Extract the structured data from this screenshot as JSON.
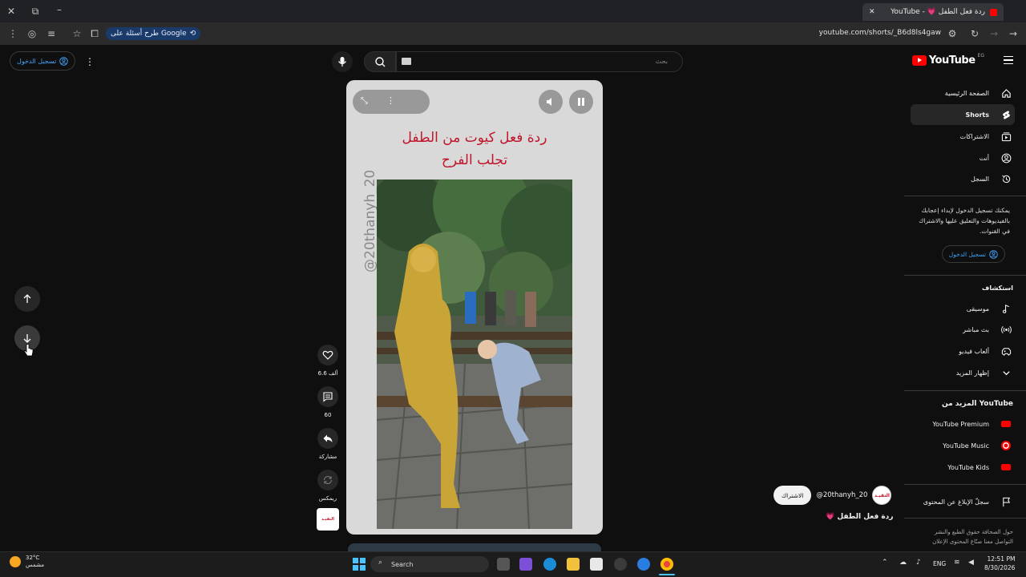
{
  "browser": {
    "tab_title": "ردة فعل الطفل 💗 - YouTube",
    "url": "youtube.com/shorts/_B6d8ls4gaw",
    "google_chip": "طرح أسئلة على Google"
  },
  "header": {
    "signin_label": "تسجيل الدخول",
    "search_placeholder": "بحث",
    "logo_text": "YouTube",
    "country_code": "EG"
  },
  "sidebar": {
    "items": [
      {
        "label": "الصفحة الرئيسية",
        "icon": "home-icon"
      },
      {
        "label": "Shorts",
        "icon": "shorts-icon"
      },
      {
        "label": "الاشتراكات",
        "icon": "subscriptions-icon"
      },
      {
        "label": "أنت",
        "icon": "you-icon"
      },
      {
        "label": "السجل",
        "icon": "history-icon"
      }
    ],
    "signin_message": "يمكنك تسجيل الدخول لإبداء إعجابك بالفيديوهات والتعليق عليها والاشتراك في القنوات.",
    "signin_button": "تسجيل الدخول",
    "explore_heading": "استكشاف",
    "explore_items": [
      {
        "label": "موسيقى",
        "icon": "music-icon"
      },
      {
        "label": "بث مباشر",
        "icon": "live-icon"
      },
      {
        "label": "ألعاب فيديو",
        "icon": "gaming-icon"
      },
      {
        "label": "إظهار المزيد",
        "icon": "chevron-down-icon"
      }
    ],
    "more_heading": "المزيد من YouTube",
    "more_items": [
      {
        "label": "YouTube Premium"
      },
      {
        "label": "YouTube Music"
      },
      {
        "label": "YouTube Kids"
      }
    ],
    "report_label": "سجلّ الإبلاغ عن المحتوى",
    "footer_line1": "حول  الصحافة  حقوق الطبع والنشر",
    "footer_line2": "التواصل معنا  صنّاع المحتوى  الإعلان"
  },
  "short": {
    "caption_line1": "ردة فعل كيوت من الطفل",
    "caption_line2": "تجلب الفرح",
    "watermark": "@20thanyh_20",
    "likes": "6.6 ألف",
    "comments": "60",
    "share_label": "مشاركة",
    "remix_label": "ريمكس",
    "channel_handle": "@20thanyh_20",
    "subscribe_label": "الاشتراك",
    "title": "ردة فعل الطفل 💗",
    "avatar_text": "التقيـد"
  },
  "taskbar": {
    "weather_temp": "32°C",
    "weather_desc": "مشمس",
    "search_label": "Search",
    "lang": "ENG",
    "time": "12:51 PM",
    "date": "8/30/2026"
  },
  "colors": {
    "accent_link": "#3ea6ff",
    "youtube_red": "#ff0000",
    "caption_red": "#c0162b"
  }
}
